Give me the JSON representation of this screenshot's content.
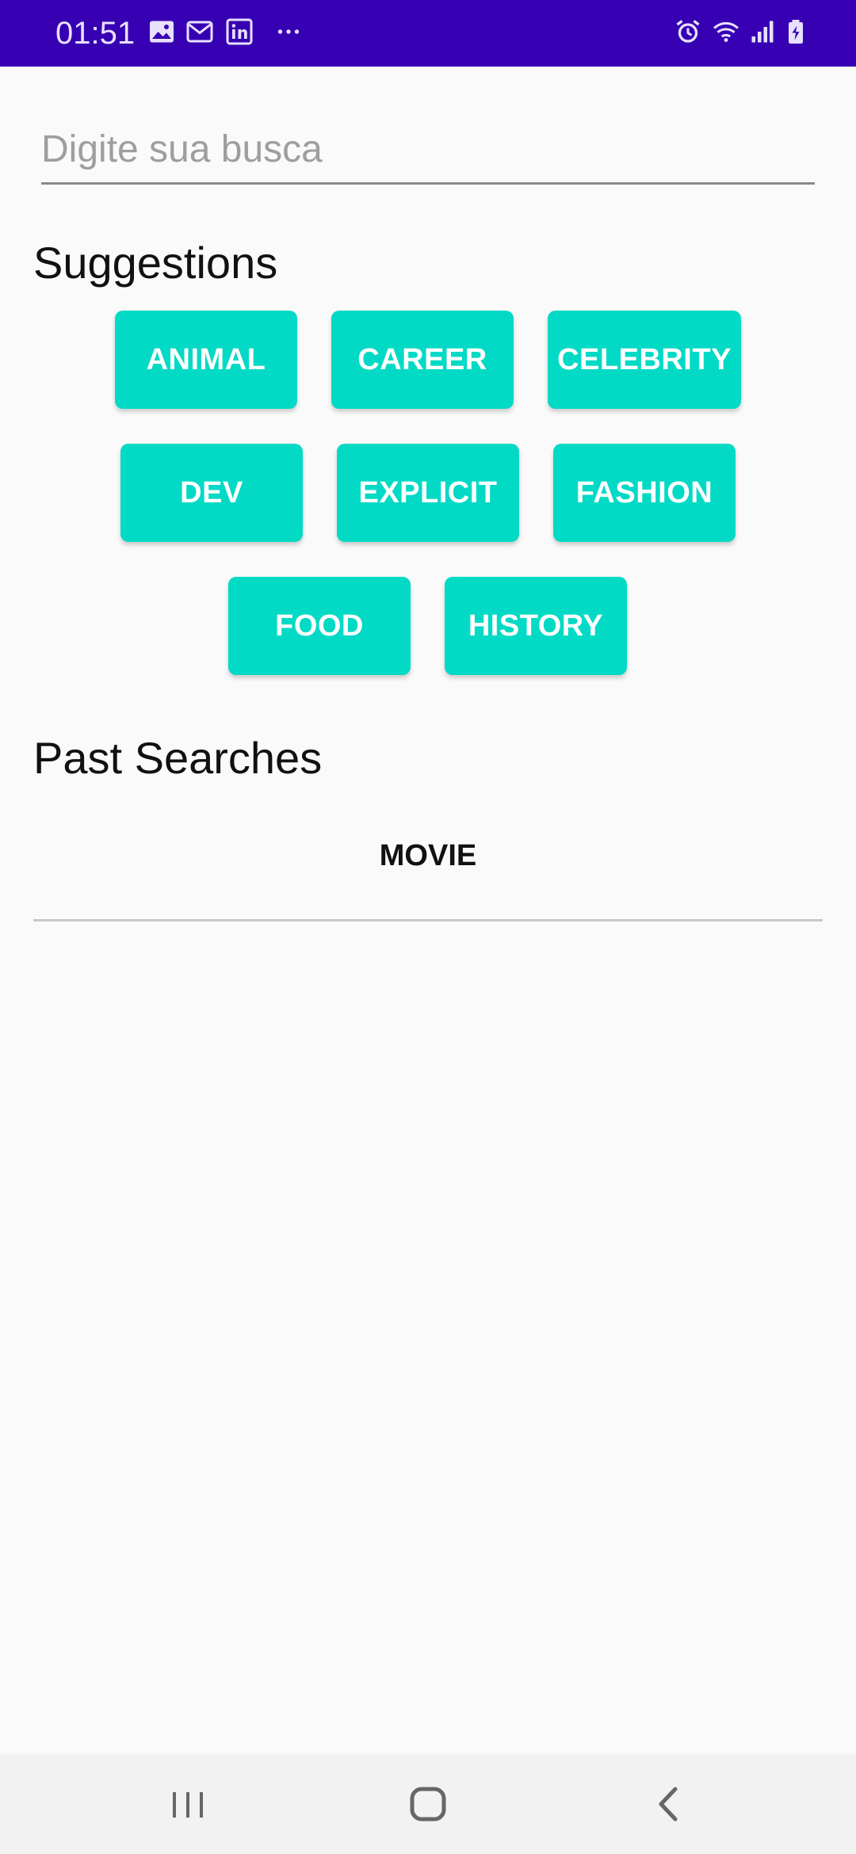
{
  "status_bar": {
    "time": "01:51",
    "icons": [
      "image-icon",
      "gmail-icon",
      "linkedin-icon",
      "more-icon",
      "alarm-icon",
      "wifi-icon",
      "signal-icon",
      "battery-charging-icon"
    ],
    "background": "#3700b3"
  },
  "search": {
    "placeholder": "Digite sua busca",
    "value": ""
  },
  "suggestions": {
    "title": "Suggestions",
    "chips": [
      "ANIMAL",
      "CAREER",
      "CELEBRITY",
      "DEV",
      "EXPLICIT",
      "FASHION",
      "FOOD",
      "HISTORY"
    ],
    "chip_color": "#03dac5"
  },
  "past_searches": {
    "title": "Past Searches",
    "items": [
      "MOVIE"
    ]
  },
  "nav_bar": {
    "icons": [
      "recents-icon",
      "home-icon",
      "back-icon"
    ]
  }
}
